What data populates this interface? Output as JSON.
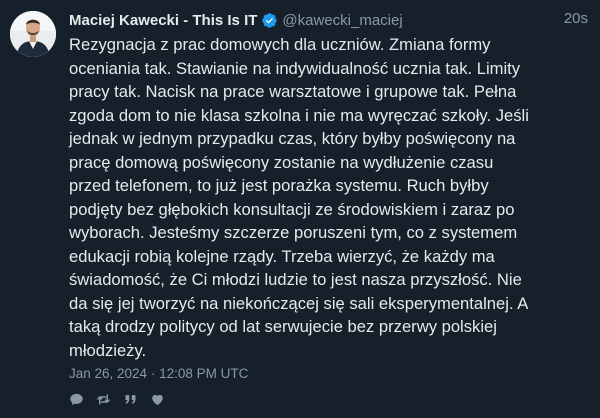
{
  "author": {
    "display_name": "Maciej Kawecki - This Is IT",
    "handle": "@kawecki_maciej",
    "verified": true
  },
  "relative_time": "20s",
  "body_lines": [
    "Rezygnacja z prac domowych dla uczniów. Zmiana formy",
    "oceniania tak. Stawianie na indywidualność ucznia tak. Limity",
    "pracy tak. Nacisk na prace warsztatowe i grupowe tak. Pełna",
    "zgoda dom to nie klasa szkolna i nie ma wyręczać szkoły. Jeśli",
    "jednak w jednym przypadku czas, który byłby poświęcony na",
    "pracę domową poświęcony zostanie na wydłużenie czasu",
    "przed telefonem, to już jest porażka systemu. Ruch byłby",
    "podjęty bez głębokich konsultacji ze środowiskiem i zaraz po",
    "wyborach. Jesteśmy szczerze poruszeni tym, co z systemem",
    "edukacji robią kolejne rządy. Trzeba wierzyć, że każdy ma",
    "świadomość, że Ci młodzi ludzie to jest nasza przyszłość. Nie",
    "da się jej tworzyć na niekończącej się sali eksperymentalnej. A",
    "taką drodzy politycy od lat serwujecie bez przerwy polskiej",
    "młodzieży."
  ],
  "timestamp": "Jan 26, 2024 · 12:08 PM UTC",
  "actions": {
    "reply_icon": "comment-icon",
    "retweet_icon": "retweet-icon",
    "quote_icon": "quote-icon",
    "like_icon": "heart-icon"
  },
  "colors": {
    "background": "#15202b",
    "text": "#e7e9ea",
    "muted": "#8b98a5",
    "verified": "#1d9bf0"
  }
}
